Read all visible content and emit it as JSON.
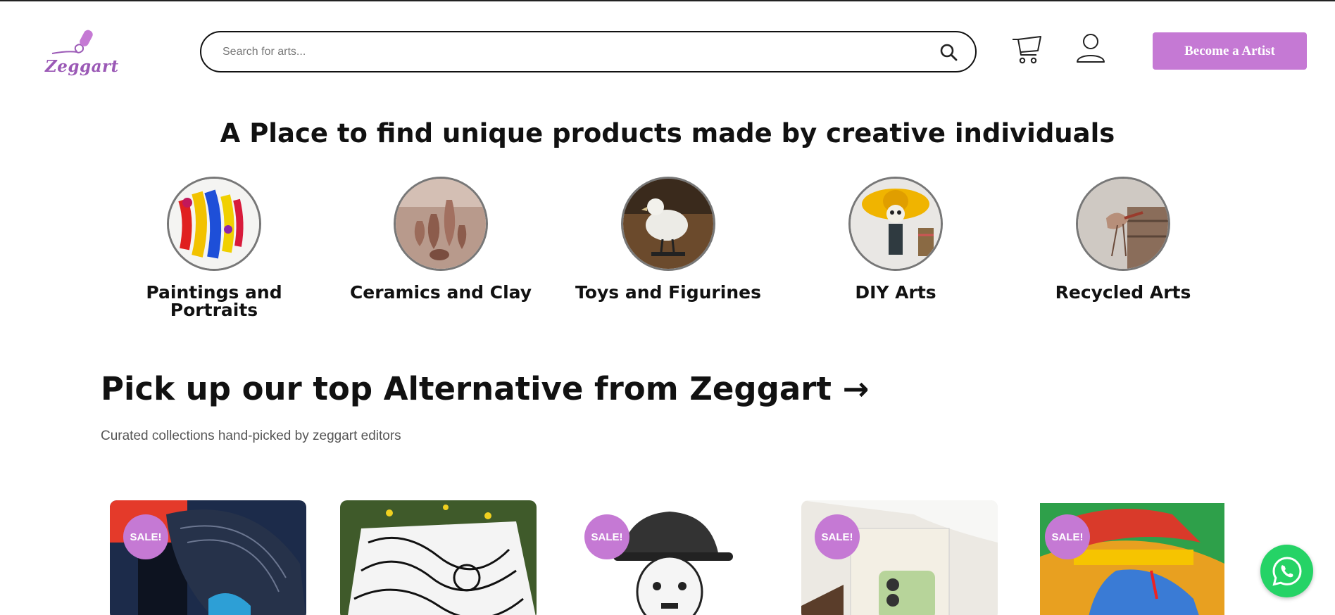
{
  "header": {
    "logo_text": "Zeggart",
    "search_placeholder": "Search for arts...",
    "search_value": "",
    "cta_label": "Become a Artist",
    "accent_color": "#c579d4"
  },
  "hero": {
    "title": "A Place to find unique products made by creative individuals"
  },
  "categories": [
    {
      "label": "Paintings and Portraits",
      "icon": "paintings-image"
    },
    {
      "label": "Ceramics and Clay",
      "icon": "ceramics-image"
    },
    {
      "label": "Toys and Figurines",
      "icon": "toys-image"
    },
    {
      "label": "DIY Arts",
      "icon": "diy-image"
    },
    {
      "label": "Recycled Arts",
      "icon": "recycled-image"
    }
  ],
  "section": {
    "title": "Pick up our top Alternative from Zeggart →",
    "subtitle": "Curated collections hand-picked by zeggart editors"
  },
  "products": [
    {
      "badge": "SALE!"
    },
    {
      "badge": ""
    },
    {
      "badge": "SALE!"
    },
    {
      "badge": "SALE!"
    },
    {
      "badge": "SALE!"
    }
  ],
  "whatsapp": {
    "icon": "whatsapp-icon",
    "color": "#25d366"
  }
}
